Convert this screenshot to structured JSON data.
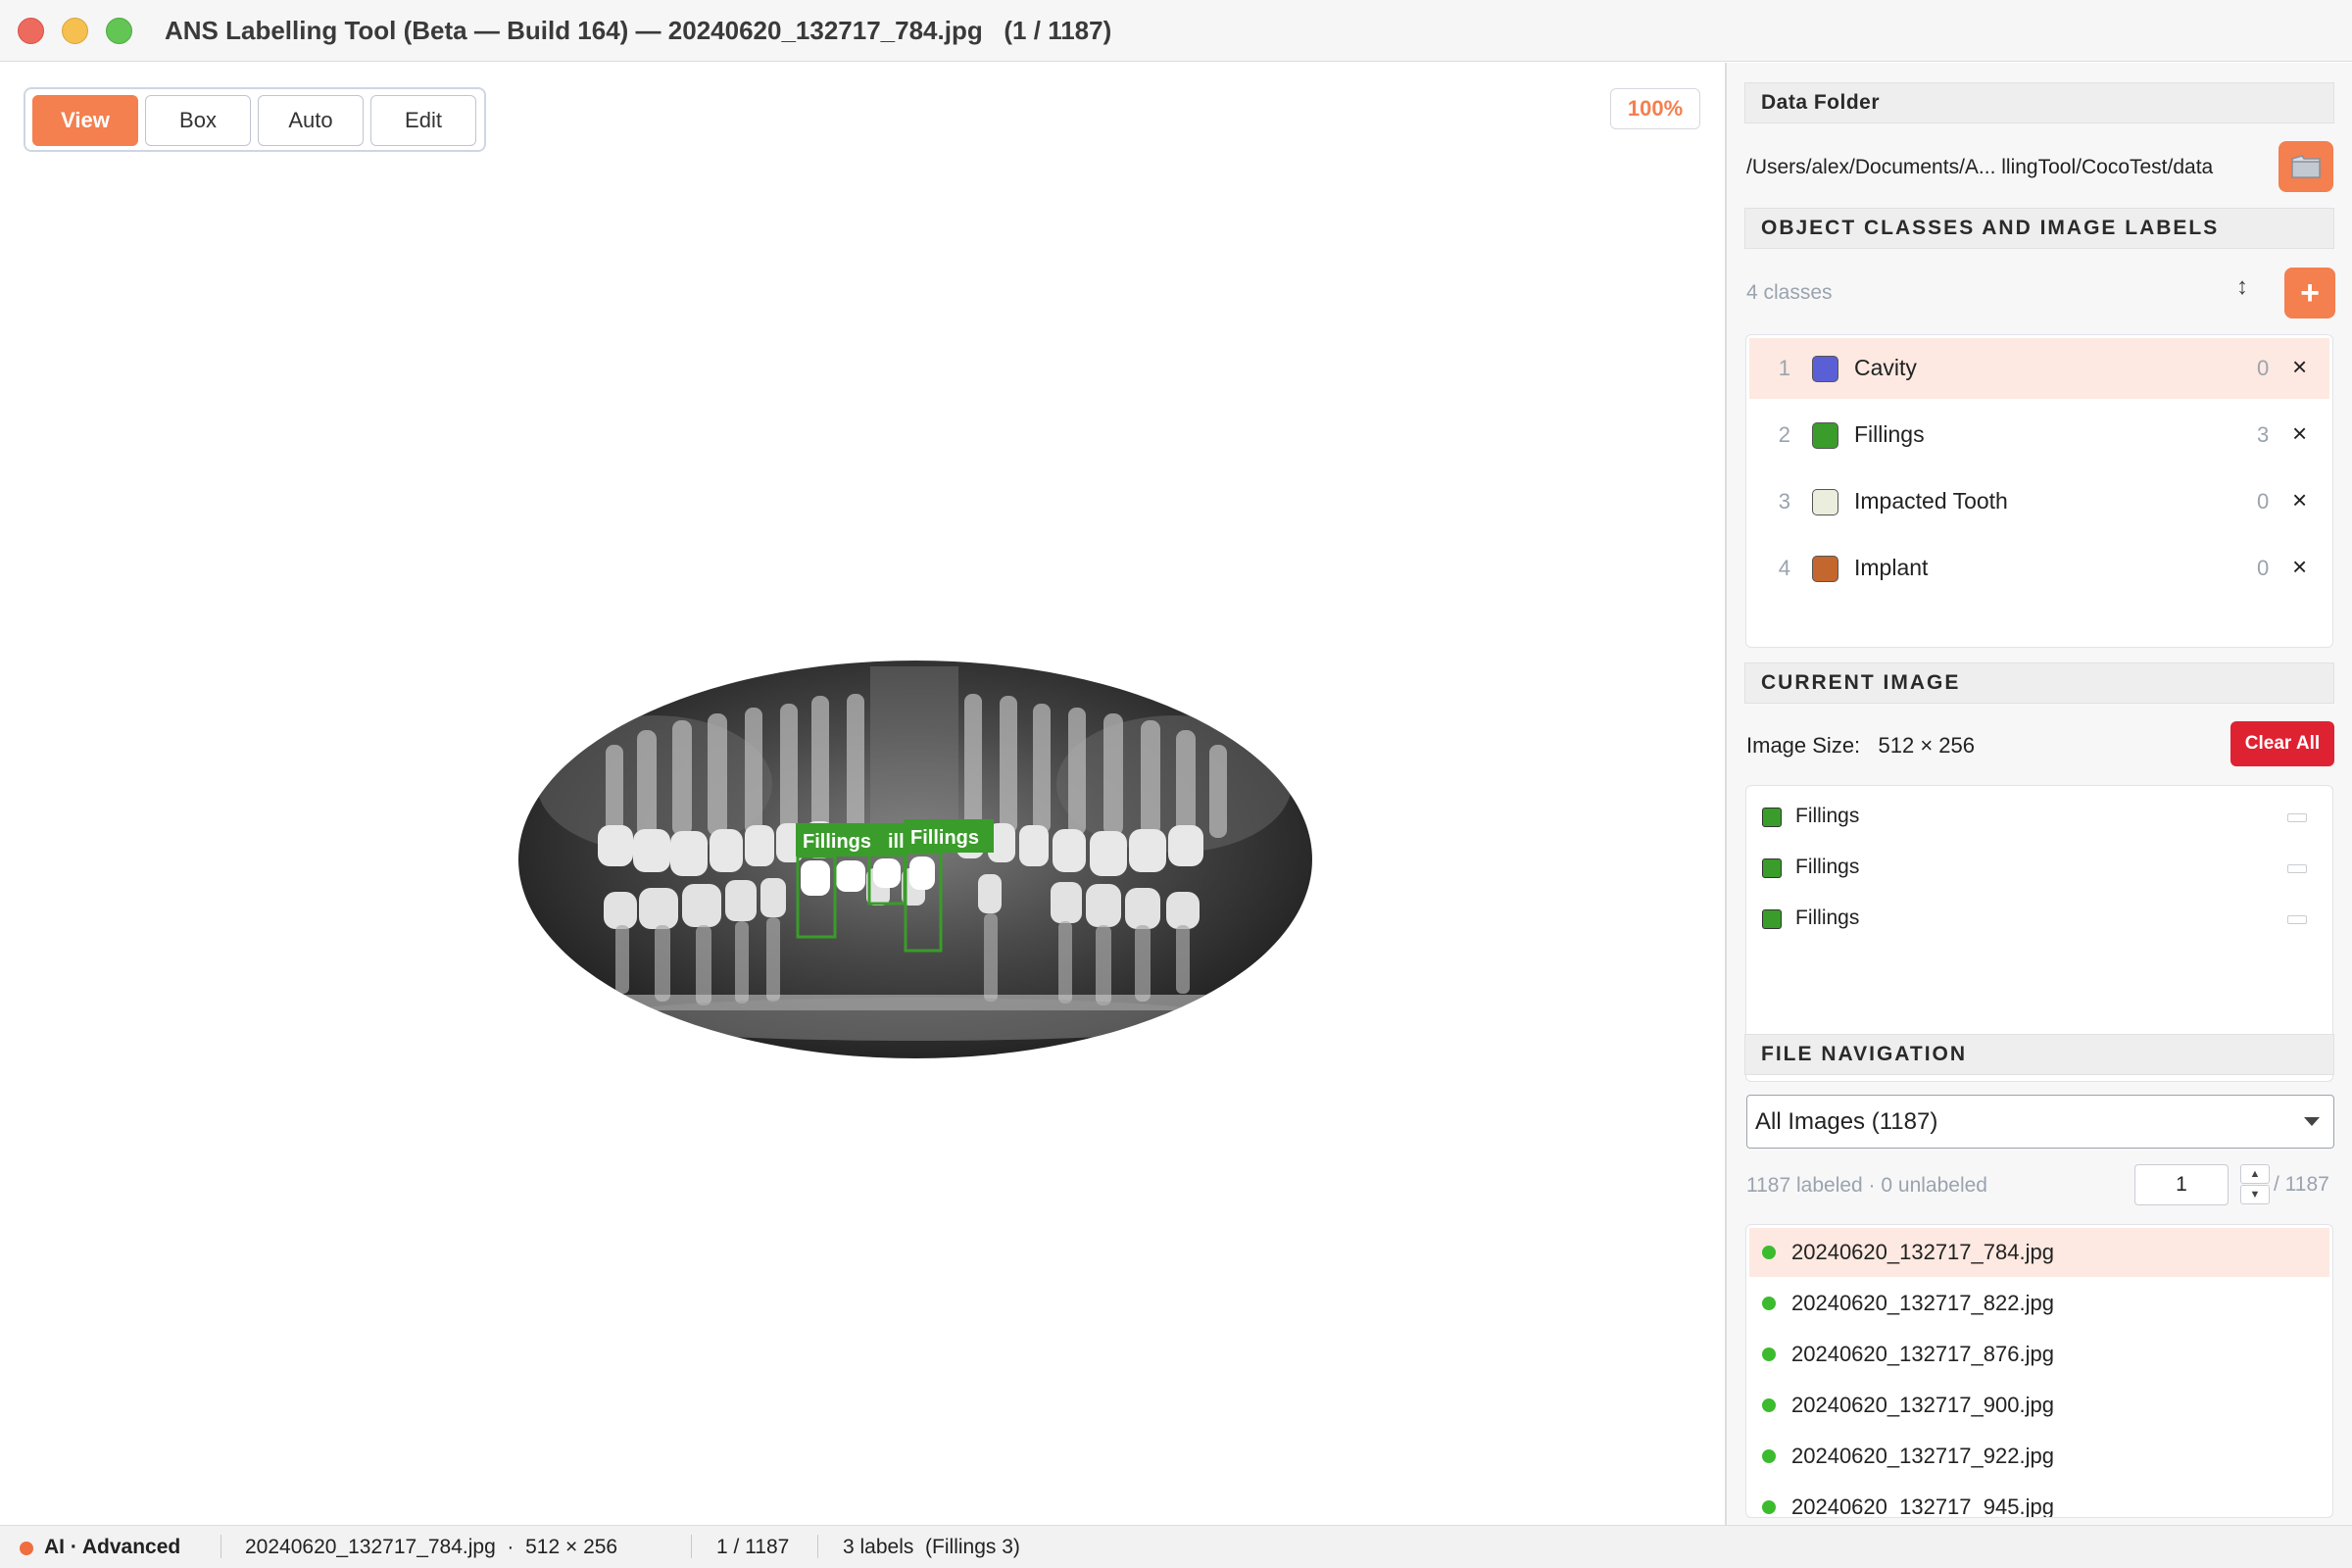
{
  "window": {
    "title": "ANS Labelling Tool (Beta — Build 164) — 20240620_132717_784.jpg   (1 / 1187)"
  },
  "toolbar": {
    "modes": [
      "View",
      "Box",
      "Auto",
      "Edit"
    ],
    "active_mode": "View",
    "zoom": "100%"
  },
  "canvas": {
    "image_kind": "dental panoramic x-ray",
    "boxes": [
      {
        "label": "Fillings",
        "color": "#3a9c2a"
      },
      {
        "label": "ill",
        "color": "#3a9c2a"
      },
      {
        "label": "Fillings",
        "color": "#3a9c2a"
      }
    ]
  },
  "panel": {
    "data_folder": {
      "heading": "Data Folder",
      "path": "/Users/alex/Documents/A... llingTool/CocoTest/data",
      "icon": "folder-icon"
    },
    "classes": {
      "heading": "OBJECT CLASSES AND IMAGE LABELS",
      "count_text": "4 classes",
      "sort_icon": "sort-icon",
      "add_label": "+",
      "items": [
        {
          "num": "1",
          "name": "Cavity",
          "color": "#5b5fd6",
          "count": "0",
          "delete": "×"
        },
        {
          "num": "2",
          "name": "Fillings",
          "color": "#3a9c2a",
          "count": "3",
          "delete": "×"
        },
        {
          "num": "3",
          "name": "Impacted Tooth",
          "color": "#ebeedd",
          "count": "0",
          "delete": "×"
        },
        {
          "num": "4",
          "name": "Implant",
          "color": "#c4672e",
          "count": "0",
          "delete": "×"
        }
      ]
    },
    "current_image": {
      "heading": "CURRENT IMAGE",
      "size_text": "Image Size:   512 × 256",
      "clear_label": "Clear All",
      "labels": [
        {
          "name": "Fillings",
          "color": "#3a9c2a"
        },
        {
          "name": "Fillings",
          "color": "#3a9c2a"
        },
        {
          "name": "Fillings",
          "color": "#3a9c2a"
        }
      ]
    },
    "file_navigation": {
      "heading": "FILE NAVIGATION",
      "filter_value": "All Images (1187)",
      "stats": "1187 labeled · 0 unlabeled",
      "page_value": "1",
      "page_total": "/ 1187",
      "files": [
        "20240620_132717_784.jpg",
        "20240620_132717_822.jpg",
        "20240620_132717_876.jpg",
        "20240620_132717_900.jpg",
        "20240620_132717_922.jpg",
        "20240620_132717_945.jpg"
      ]
    }
  },
  "statusbar": {
    "mode": "AI · Advanced",
    "file_info": "20240620_132717_784.jpg  ·  512 × 256",
    "position": "1 / 1187",
    "labels_summary": "3 labels  (Fillings 3)"
  },
  "colors": {
    "accent": "#f47f4f",
    "danger": "#df2232",
    "selected_row": "#fde9e1",
    "labeled_dot": "#3dbb2f"
  }
}
